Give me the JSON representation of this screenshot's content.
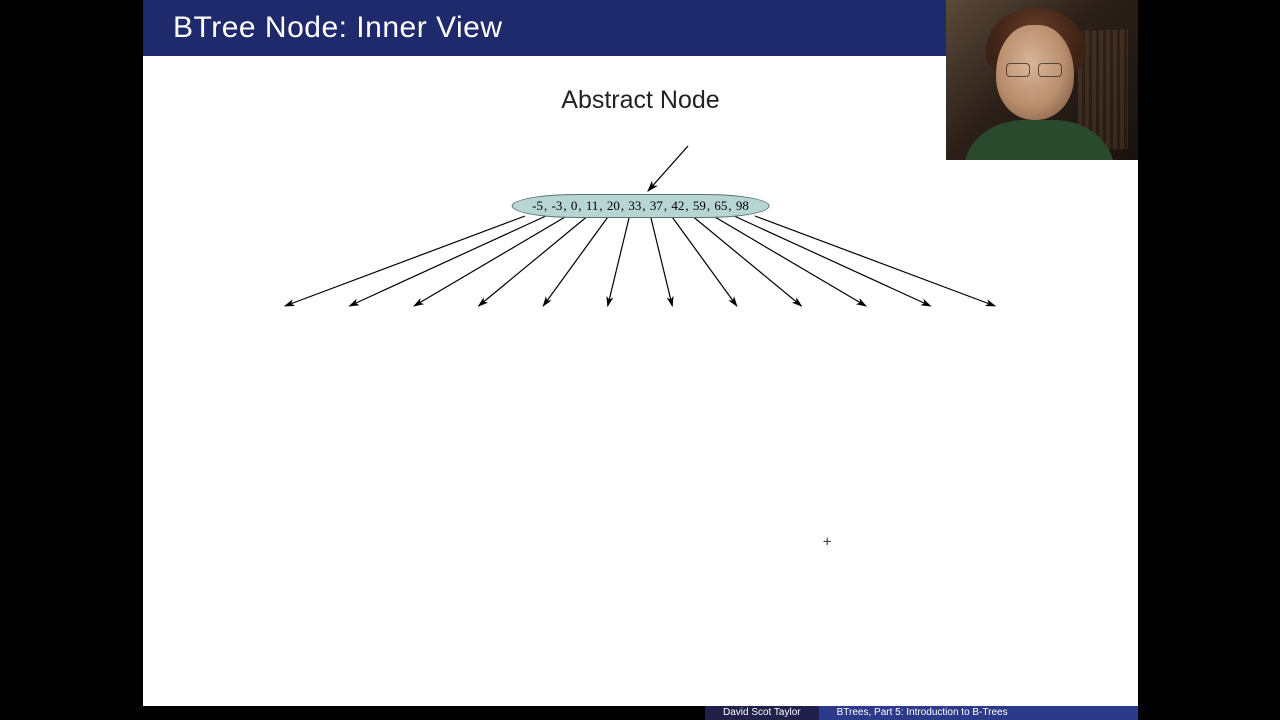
{
  "titlebar": {
    "title": "BTree Node: Inner View"
  },
  "section": {
    "heading": "Abstract Node"
  },
  "node": {
    "values": [
      -5,
      -3,
      0,
      11,
      20,
      33,
      37,
      42,
      59,
      65,
      98
    ]
  },
  "footer": {
    "author": "David Scot Taylor",
    "lecture": "BTrees, Part 5: Introduction to B-Trees"
  },
  "diagram": {
    "num_children": 12
  }
}
